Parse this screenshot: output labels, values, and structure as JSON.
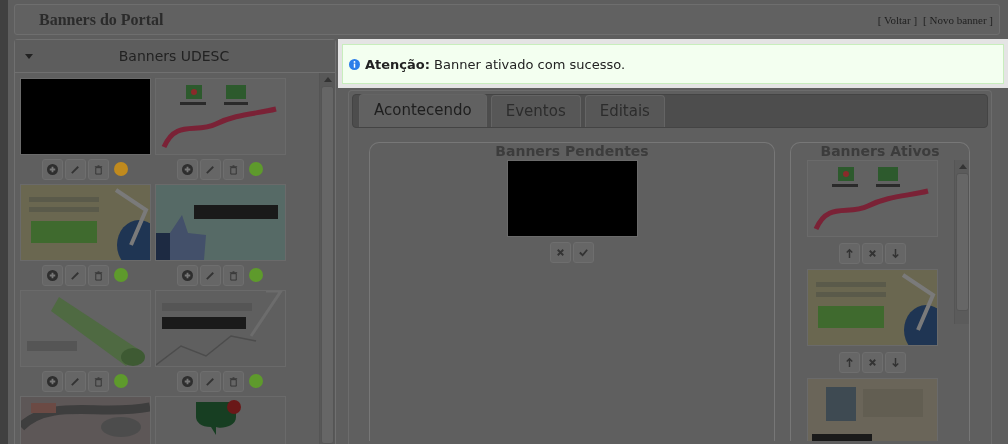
{
  "page": {
    "title": "Banners do Portal",
    "links": [
      "[ Voltar ]",
      "[ Novo banner ]"
    ]
  },
  "notification": {
    "message": "**Atenção:** Banner ativado com sucesso."
  },
  "sidebar": {
    "title": "Banners UDESC",
    "expanded": true
  },
  "tabs": [
    {
      "label": "Acontecendo",
      "selected": true
    },
    {
      "label": "Eventos",
      "selected": false
    },
    {
      "label": "Editais",
      "selected": false
    }
  ],
  "pending": {
    "title": "Banners Pendentes"
  },
  "active": {
    "title": "Banners Ativos"
  }
}
